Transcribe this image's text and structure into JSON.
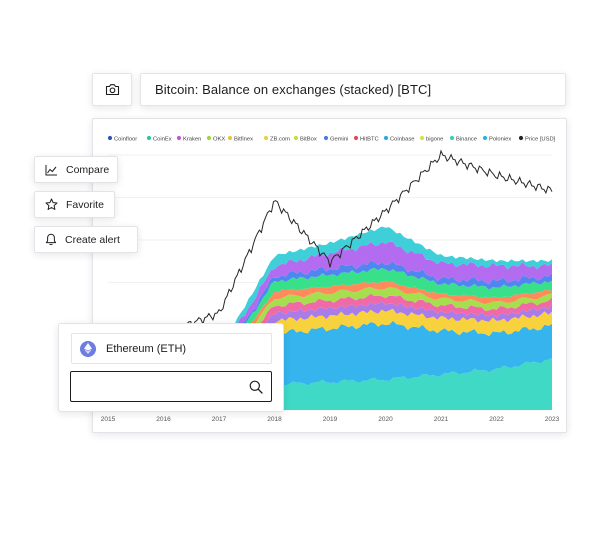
{
  "title_bar": {
    "title": "Bitcoin: Balance on exchanges (stacked) [BTC]"
  },
  "actions": {
    "compare_label": "Compare",
    "favorite_label": "Favorite",
    "alert_label": "Create alert"
  },
  "asset_panel": {
    "selected_asset": "Ethereum (ETH)",
    "search_placeholder": ""
  },
  "chart_data": {
    "type": "area",
    "stacked": true,
    "title": "Bitcoin: Balance on exchanges (stacked) [BTC]",
    "legend_position": "top",
    "grid": true,
    "x": [
      "2015",
      "2016",
      "2017",
      "2018",
      "2019",
      "2020",
      "2021",
      "2022",
      "2023"
    ],
    "series_colors": {
      "Coinbase": "#2ea7e0",
      "Binance": "#36d1b8",
      "Poloniex": "#2bb4e3",
      "Price [USD]": "#262626"
    },
    "legend": [
      {
        "name": "Coinfloor",
        "color": "#2f55b6"
      },
      {
        "name": "CoinEx",
        "color": "#2fc4a0"
      },
      {
        "name": "Kraken",
        "color": "#c156d6"
      },
      {
        "name": "OKX",
        "color": "#9dd63f"
      },
      {
        "name": "Bitfinex",
        "color": "#e8c53a"
      },
      {
        "name": "ZB.com",
        "color": "#e6d24d"
      },
      {
        "name": "BitBox",
        "color": "#c6dd3e"
      },
      {
        "name": "Gemini",
        "color": "#4b7be0"
      },
      {
        "name": "HitBTC",
        "color": "#e0495a"
      },
      {
        "name": "Coinbase",
        "color": "#2ea7e0"
      },
      {
        "name": "bigone",
        "color": "#d8e04a"
      },
      {
        "name": "Binance",
        "color": "#36d1b8"
      },
      {
        "name": "Poloniex",
        "color": "#2bb4e3"
      },
      {
        "name": "Price [USD]",
        "color": "#262626"
      }
    ],
    "layers": [
      {
        "color": "#3fd9c6",
        "values": [
          0,
          0,
          0.02,
          0.1,
          0.11,
          0.12,
          0.14,
          0.16,
          0.2
        ]
      },
      {
        "color": "#35b4ee",
        "values": [
          0,
          0,
          0.07,
          0.2,
          0.21,
          0.22,
          0.17,
          0.14,
          0.13
        ]
      },
      {
        "color": "#f7d23c",
        "values": [
          0,
          0,
          0.02,
          0.05,
          0.05,
          0.05,
          0.05,
          0.05,
          0.05
        ]
      },
      {
        "color": "#a97ce8",
        "values": [
          0,
          0,
          0.015,
          0.03,
          0.03,
          0.03,
          0.025,
          0.02,
          0.025
        ]
      },
      {
        "color": "#f06aa8",
        "values": [
          0,
          0,
          0.015,
          0.03,
          0.03,
          0.03,
          0.025,
          0.025,
          0.025
        ]
      },
      {
        "color": "#a6df4e",
        "values": [
          0,
          0,
          0.015,
          0.03,
          0.03,
          0.03,
          0.025,
          0.025,
          0.02
        ]
      },
      {
        "color": "#ff8a5c",
        "values": [
          0,
          0,
          0.01,
          0.025,
          0.025,
          0.025,
          0.02,
          0.02,
          0.02
        ]
      },
      {
        "color": "#38e08a",
        "values": [
          0,
          0,
          0.02,
          0.04,
          0.045,
          0.05,
          0.04,
          0.04,
          0.035
        ]
      },
      {
        "color": "#4f86f0",
        "values": [
          0,
          0,
          0.01,
          0.02,
          0.025,
          0.025,
          0.02,
          0.025,
          0.02
        ]
      },
      {
        "color": "#b36bf0",
        "values": [
          0,
          0,
          0.02,
          0.04,
          0.06,
          0.08,
          0.06,
          0.06,
          0.04
        ]
      },
      {
        "color": "#3ecfd8",
        "values": [
          0,
          0,
          0.02,
          0.04,
          0.04,
          0.06,
          0.03,
          0.02,
          0.02
        ]
      }
    ],
    "price_line": {
      "name": "Price [USD]",
      "values": [
        0.22,
        0.3,
        0.38,
        0.82,
        0.58,
        0.78,
        1.0,
        0.92,
        0.86
      ]
    }
  }
}
